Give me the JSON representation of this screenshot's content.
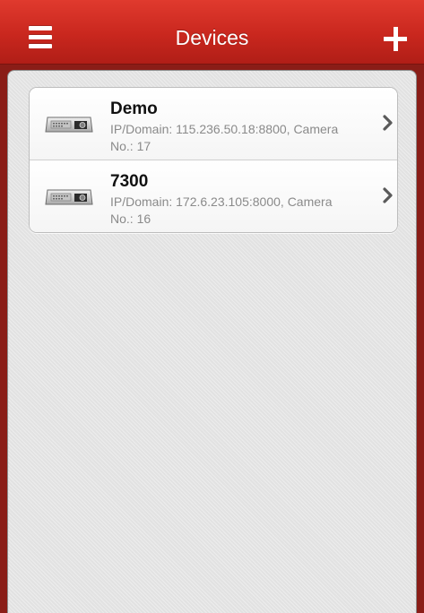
{
  "header": {
    "title": "Devices",
    "menu_icon": "hamburger-menu-icon",
    "add_icon": "plus-icon",
    "bar_color": "#c9271e"
  },
  "devices": [
    {
      "name": "Demo",
      "detail": "IP/Domain: 115.236.50.18:8800, Camera No.: 17",
      "icon": "dvr-device-icon"
    },
    {
      "name": "7300",
      "detail": "IP/Domain: 172.6.23.105:8000, Camera No.: 16",
      "icon": "dvr-device-icon"
    }
  ]
}
